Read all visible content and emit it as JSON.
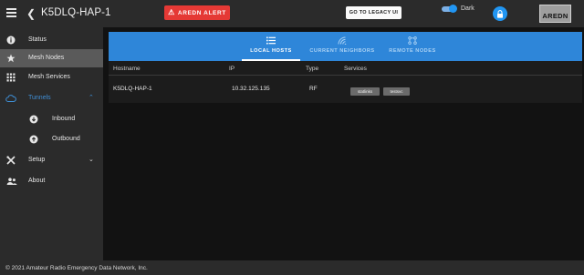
{
  "header": {
    "node_name": "K5DLQ-HAP-1",
    "alert_label": "AREDN ALERT",
    "legacy_label": "GO TO LEGACY UI",
    "dark_label": "Dark",
    "logo_text": "AREDN"
  },
  "sidebar": {
    "items": [
      {
        "label": "Status",
        "icon": "info-icon"
      },
      {
        "label": "Mesh Nodes",
        "icon": "star-icon"
      },
      {
        "label": "Mesh Services",
        "icon": "grid-icon"
      },
      {
        "label": "Tunnels",
        "icon": "cloud-icon"
      },
      {
        "label": "Inbound",
        "icon": "download-circle-icon"
      },
      {
        "label": "Outbound",
        "icon": "upload-circle-icon"
      },
      {
        "label": "Setup",
        "icon": "tools-icon"
      },
      {
        "label": "About",
        "icon": "people-icon"
      }
    ]
  },
  "tabs": [
    {
      "label": "LOCAL HOSTS",
      "icon": "list-icon"
    },
    {
      "label": "CURRENT NEIGHBORS",
      "icon": "wifi-icon"
    },
    {
      "label": "REMOTE NODES",
      "icon": "network-icon"
    }
  ],
  "table": {
    "headers": [
      "Hostname",
      "IP",
      "Type",
      "Services"
    ],
    "rows": [
      {
        "hostname": "K5DLQ-HAP-1",
        "ip": "10.32.125.135",
        "type": "RF",
        "services": [
          "statlinks",
          "testsvc"
        ]
      }
    ]
  },
  "footer": {
    "text": "© 2021 Amateur Radio Emergency Data Network, Inc."
  },
  "colors": {
    "accent": "#2e86d9",
    "alert": "#e53935",
    "sidebar_bg": "#2b2b2b",
    "body_bg": "#121212"
  }
}
